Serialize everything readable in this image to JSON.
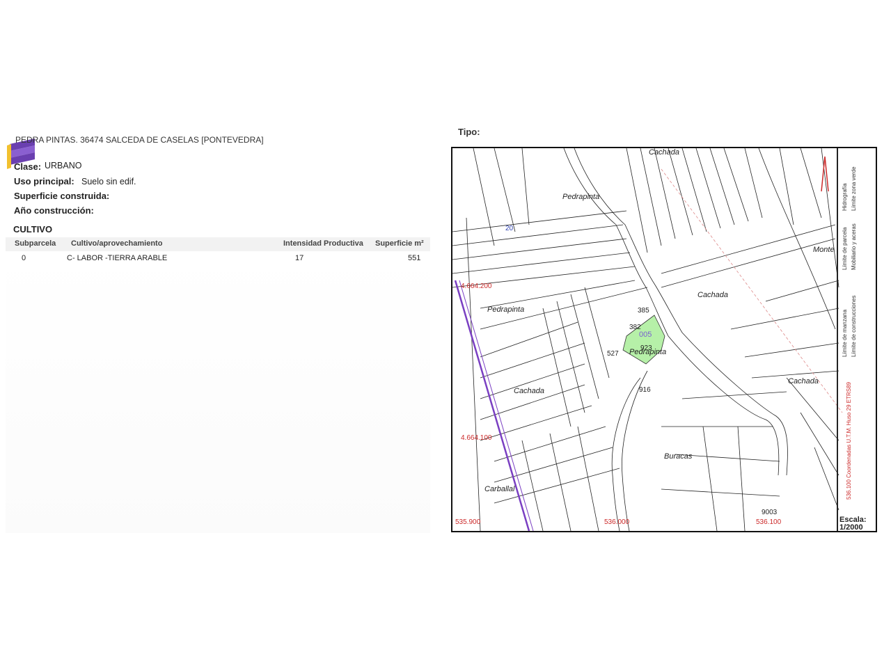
{
  "header": {
    "address": "PEDRA PINTAS. 36474 SALCEDA DE CASELAS [PONTEVEDRA]"
  },
  "details": {
    "clase_label": "Clase:",
    "clase_value": "URBANO",
    "uso_label": "Uso principal:",
    "uso_value": "Suelo sin edif.",
    "superficie_label": "Superficie construida:",
    "ano_label": "Año construcción:"
  },
  "cultivo": {
    "title": "CULTIVO",
    "columns": [
      "Subparcela",
      "Cultivo/aprovechamiento",
      "Intensidad Productiva",
      "Superficie m²"
    ],
    "rows": [
      [
        "0",
        "C- LABOR -TIERRA ARABLE",
        "17",
        "551"
      ]
    ]
  },
  "map": {
    "tipo_label": "Tipo:",
    "place_names": [
      "Cachada",
      "Pedrapinta",
      "Pedrapinta",
      "Cachada",
      "Monte",
      "Pedrapinta",
      "Cachada",
      "Cachada",
      "Buracas",
      "Carballal"
    ],
    "parcel_numbers": [
      "20",
      "385",
      "382",
      "005",
      "923",
      "527",
      "916",
      "9003"
    ],
    "coords": [
      "4.664.200",
      "4.664.100",
      "535.900",
      "536.000",
      "536.100"
    ],
    "highlight_color": "#b6f0a8",
    "accent_purple": "#7a3fc2",
    "coord_red": "#cc2a2a",
    "legend": {
      "col1": [
        "Límite de manzana",
        "Límite de parcela",
        "Hidrografía"
      ],
      "col2": [
        "Límite de construcciones",
        "Mobiliario y aceras",
        "Límite zona verde"
      ],
      "coords_note": "536.100 Coordenadas U.T.M. Huso 29 ETRS89"
    },
    "escala_label": "Escala:",
    "escala_value": "1/2000"
  },
  "logo": {
    "icon": "agency-logo-icon",
    "colors": [
      "#6a3fb0",
      "#f2c12e"
    ]
  }
}
